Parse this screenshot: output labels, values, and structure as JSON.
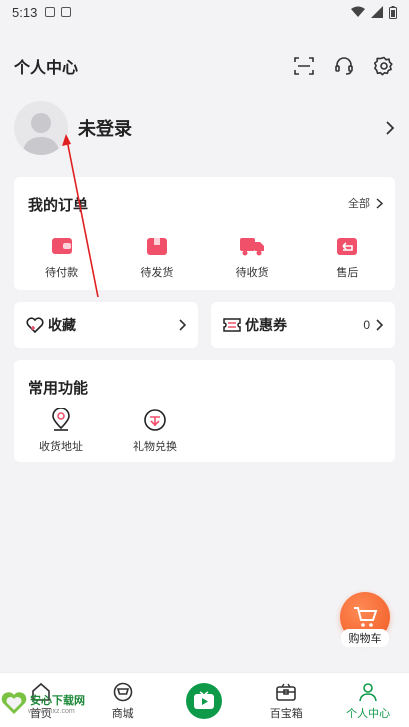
{
  "status_bar": {
    "time": "5:13"
  },
  "header": {
    "title": "个人中心"
  },
  "profile": {
    "name": "未登录"
  },
  "orders": {
    "title": "我的订单",
    "all_label": "全部",
    "items": [
      {
        "label": "待付款",
        "icon": "wallet-icon"
      },
      {
        "label": "待发货",
        "icon": "package-icon"
      },
      {
        "label": "待收货",
        "icon": "truck-icon"
      },
      {
        "label": "售后",
        "icon": "return-icon"
      }
    ]
  },
  "favorites": {
    "label": "收藏"
  },
  "coupons": {
    "label": "优惠券",
    "count": "0"
  },
  "functions": {
    "title": "常用功能",
    "items": [
      {
        "label": "收货地址",
        "icon": "location-pin-icon"
      },
      {
        "label": "礼物兑换",
        "icon": "gift-exchange-icon"
      }
    ]
  },
  "cart_fab": {
    "label": "购物车"
  },
  "tabbar": {
    "items": [
      {
        "label": "首页",
        "icon": "home-icon"
      },
      {
        "label": "商城",
        "icon": "shop-icon"
      },
      {
        "label": "",
        "icon": "video-play-icon"
      },
      {
        "label": "百宝箱",
        "icon": "treasure-box-icon"
      },
      {
        "label": "个人中心",
        "icon": "person-icon"
      }
    ]
  },
  "watermark": {
    "text": "安心下载网",
    "sub": "www.anxz.com"
  },
  "colors": {
    "accent": "#0f9a4a",
    "order_icon": "#f0506a",
    "cart": "#f05a23",
    "arrow": "#e02020"
  }
}
